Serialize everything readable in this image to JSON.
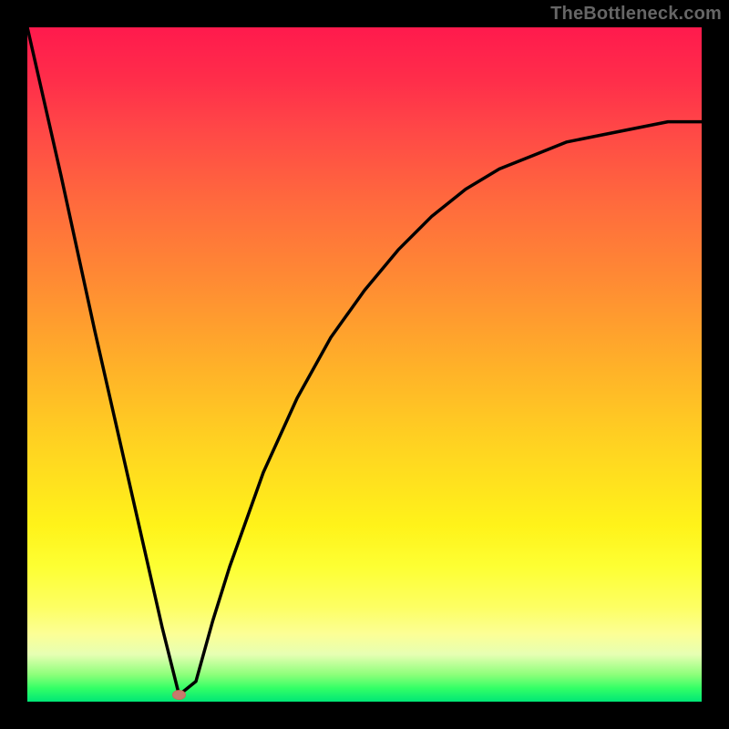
{
  "watermark": "TheBottleneck.com",
  "chart_data": {
    "type": "line",
    "title": "",
    "xlabel": "",
    "ylabel": "",
    "xlim": [
      0,
      100
    ],
    "ylim": [
      0,
      100
    ],
    "grid": false,
    "legend": false,
    "background": "red-yellow-green vertical gradient",
    "series": [
      {
        "name": "bottleneck-curve",
        "x": [
          0,
          5,
          10,
          15,
          20,
          22.5,
          25,
          27.5,
          30,
          35,
          40,
          45,
          50,
          55,
          60,
          65,
          70,
          75,
          80,
          85,
          90,
          95,
          100
        ],
        "y": [
          100,
          78,
          55,
          33,
          11,
          1,
          3,
          12,
          20,
          34,
          45,
          54,
          61,
          67,
          72,
          76,
          79,
          81,
          83,
          84,
          85,
          86,
          86
        ]
      }
    ],
    "marker": {
      "x": 22.5,
      "y": 1,
      "color": "#c77b6d"
    }
  }
}
